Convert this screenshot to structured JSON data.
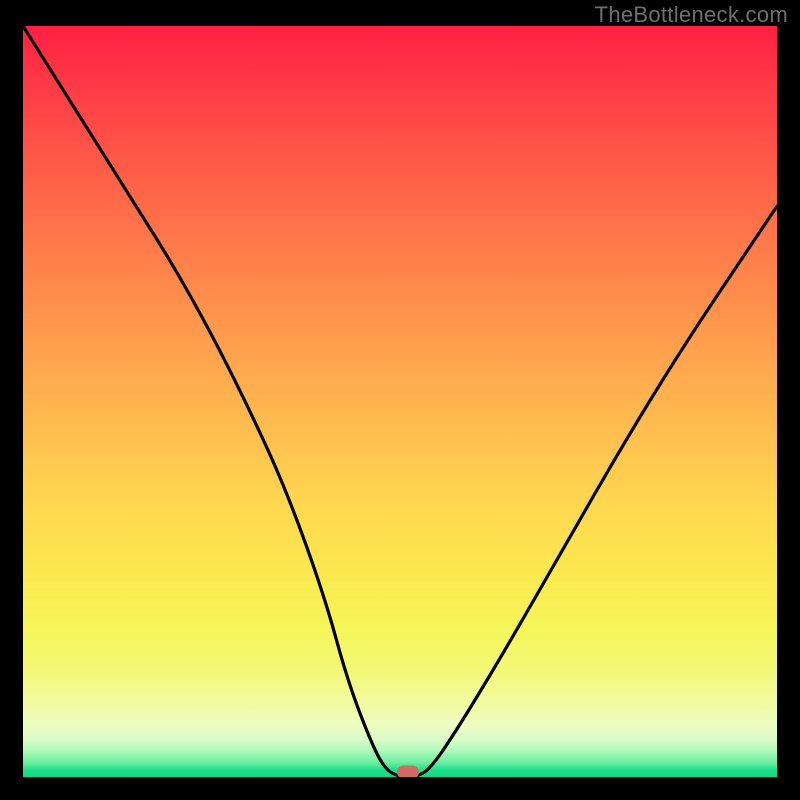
{
  "watermark": "TheBottleneck.com",
  "chart_data": {
    "type": "line",
    "title": "",
    "xlabel": "",
    "ylabel": "",
    "xlim": [
      0,
      100
    ],
    "ylim": [
      0,
      100
    ],
    "grid": false,
    "legend": false,
    "series": [
      {
        "name": "bottleneck-curve",
        "color": "#000000",
        "x": [
          0,
          5,
          10,
          15,
          20,
          25,
          30,
          35,
          40,
          43,
          46,
          48,
          50,
          52,
          54,
          58,
          64,
          72,
          80,
          88,
          96,
          100
        ],
        "y": [
          100,
          92,
          84,
          76,
          68,
          59,
          49,
          38,
          24,
          13,
          5,
          1,
          0,
          0,
          1,
          7,
          17,
          31,
          45,
          58,
          70,
          76
        ]
      }
    ],
    "marker": {
      "x": 51,
      "y": 0.6,
      "color": "#cf6b63"
    },
    "background_gradient": {
      "top": "#ff1f42",
      "mid": "#ffd84f",
      "bottom": "#0ed884"
    }
  }
}
